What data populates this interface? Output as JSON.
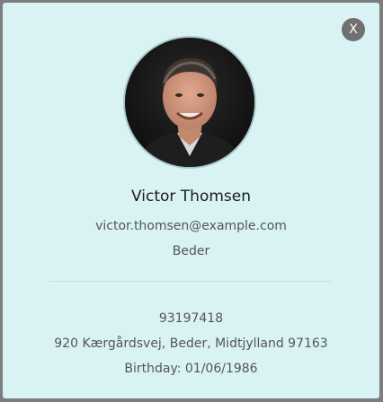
{
  "dialog": {
    "close_label": "X",
    "profile": {
      "name": "Victor Thomsen",
      "email": "victor.thomsen@example.com",
      "city": "Beder",
      "phone": "93197418",
      "address": "920 Kærgårdsvej, Beder, Midtjylland 97163",
      "birthday": "Birthday: 01/06/1986"
    }
  },
  "colors": {
    "card_background": "#d9f3f4",
    "backdrop": "#7d7d7d",
    "close_button": "#707070"
  }
}
